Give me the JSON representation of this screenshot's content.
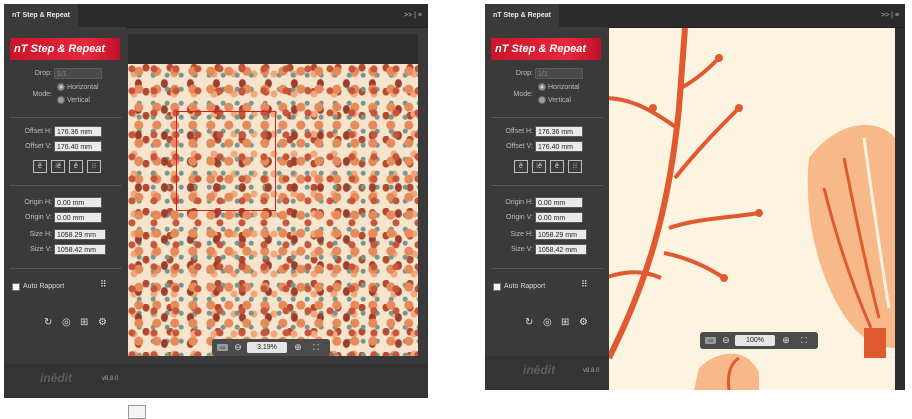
{
  "left": {
    "tab_title": "nT Step & Repeat",
    "tab_controls": ">> | ≡",
    "logo_text": "nT Step & Repeat",
    "drop_label": "Drop:",
    "drop_value": "1/1",
    "mode_label": "Mode:",
    "mode_horizontal": "Horizontal",
    "mode_vertical": "Vertical",
    "offset_h_label": "Offset H:",
    "offset_h_value": "176.36 mm",
    "offset_v_label": "Offset V:",
    "offset_v_value": "176.40 mm",
    "icon_buttons": [
      "ẽ",
      "⁝ẽ",
      "ẽ",
      "⁝⁝"
    ],
    "origin_h_label": "Origin H:",
    "origin_h_value": "0.00 mm",
    "origin_v_label": "Origin V:",
    "origin_v_value": "0.00 mm",
    "size_h_label": "Size H:",
    "size_h_value": "1058.29 mm",
    "size_v_label": "Size V:",
    "size_v_value": "1058.42 mm",
    "auto_rapport_label": "Auto Rapport",
    "brand": "inēdit",
    "version": "v8.8.0",
    "zoom_value": "3.19%",
    "hd_label": "HD"
  },
  "right": {
    "tab_title": "nT Step & Repeat",
    "tab_controls": ">> | ≡",
    "logo_text": "nT Step & Repeat",
    "drop_label": "Drop:",
    "drop_value": "1/1",
    "mode_label": "Mode:",
    "mode_horizontal": "Horizontal",
    "mode_vertical": "Vertical",
    "offset_h_label": "Offset H:",
    "offset_h_value": "176.36 mm",
    "offset_v_label": "Offset V:",
    "offset_v_value": "176.40 mm",
    "icon_buttons": [
      "ẽ",
      "⁝ẽ",
      "ẽ",
      "⁝⁝"
    ],
    "origin_h_label": "Origin H:",
    "origin_h_value": "0.00 mm",
    "origin_v_label": "Origin V:",
    "origin_v_value": "0.00 mm",
    "size_h_label": "Size H:",
    "size_h_value": "1058.29 mm",
    "size_v_label": "Size V:",
    "size_v_value": "1058.42 mm",
    "auto_rapport_label": "Auto Rapport",
    "brand": "inēdit",
    "version": "v8.8.0",
    "zoom_value": "100%",
    "hd_label": "HD"
  },
  "tool_icons": [
    "refresh-icon",
    "target-icon",
    "grid-icon",
    "gear-icon"
  ],
  "colors": {
    "panel_bg": "#3a3a3a",
    "accent_red": "#d81f33",
    "selection_red": "#d42020",
    "pattern_bg": "#f7e4cc",
    "botanical_orange": "#e0592f",
    "botanical_peach": "#f8b98a",
    "canvas_cream": "#fdf3e1"
  }
}
